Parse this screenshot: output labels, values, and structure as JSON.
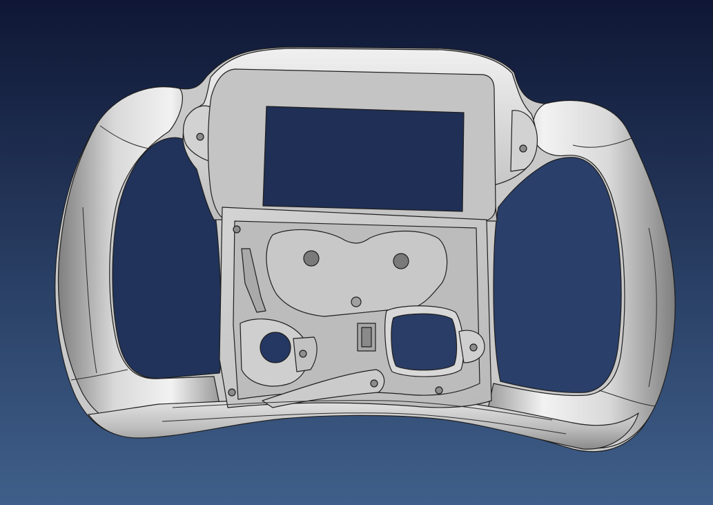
{
  "viewport": {
    "background_top": "#0f1735",
    "background_bottom": "#3f5f8a"
  },
  "model": {
    "part_name": "steering-wheel",
    "surface_color": "#c9c9c9",
    "surface_highlight": "#f2f2f2",
    "surface_shadow": "#7f7f7f",
    "edge_color": "#1e1e1e"
  }
}
